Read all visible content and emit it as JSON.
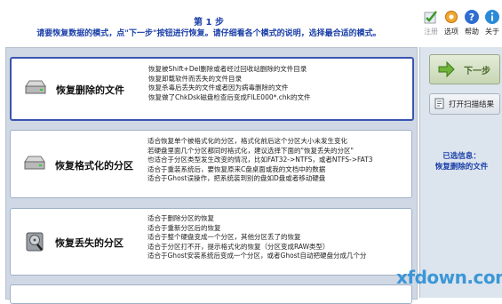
{
  "header": {
    "step_title": "第 1 步",
    "step_desc": "请要恢复数据的模式，点\"下一步\"按钮进行恢复。请仔细看各个模式的说明，选择最合适的模式。"
  },
  "toolbar": {
    "items": [
      {
        "label": "注册",
        "icon": "register-icon"
      },
      {
        "label": "选项",
        "icon": "gear-icon"
      },
      {
        "label": "帮助",
        "icon": "help-icon"
      },
      {
        "label": "关于",
        "icon": "about-icon"
      }
    ]
  },
  "modes": [
    {
      "title": "恢复删除的文件",
      "icon": "drive-icon",
      "selected": true,
      "lines": [
        "恢复被Shift+Del删除或者经过回收站删除的文件目录",
        "恢复卸载软件而丢失的文件目录",
        "恢复杀毒后丢失的文件或者因为病毒删除的文件",
        "恢复做了ChkDsk磁盘检查后变成FILE000*.chk的文件"
      ]
    },
    {
      "title": "恢复格式化的分区",
      "icon": "drive-icon",
      "selected": false,
      "lines": [
        "适合恢复单个被格式化的分区，格式化前后这个分区大小未发生变化",
        "若硬盘里面几个分区都同时格式化，建议选择下面的\"恢复丢失的分区\"",
        "也适合于分区类型发生改变的情况，比如FAT32->NTFS，或者NTFS->FAT3",
        "适合于重装系统后，要恢复原来C盘桌面或我的文档中的数据",
        "适合于Ghost误操作，把系统装到别的盘如D盘或者移动硬盘"
      ]
    },
    {
      "title": "恢复丢失的分区",
      "icon": "disk-search-icon",
      "selected": false,
      "lines": [
        "适合于删除分区的恢复",
        "适合于重新分区后的恢复",
        "适合于整个硬盘变成一个分区，其他分区丢了的恢复",
        "适合于分区打不开，提示格式化的恢复（分区变成RAW类型）",
        "适合于Ghost安装系统后变成一个分区，或者Ghost自动把硬盘分成几个分"
      ]
    }
  ],
  "right_panel": {
    "next_label": "下一步",
    "open_label": "打开扫描结果",
    "selected_prefix": "已选信息：",
    "selected_value": "恢复删除的文件"
  },
  "watermark": "xfdown.com"
}
